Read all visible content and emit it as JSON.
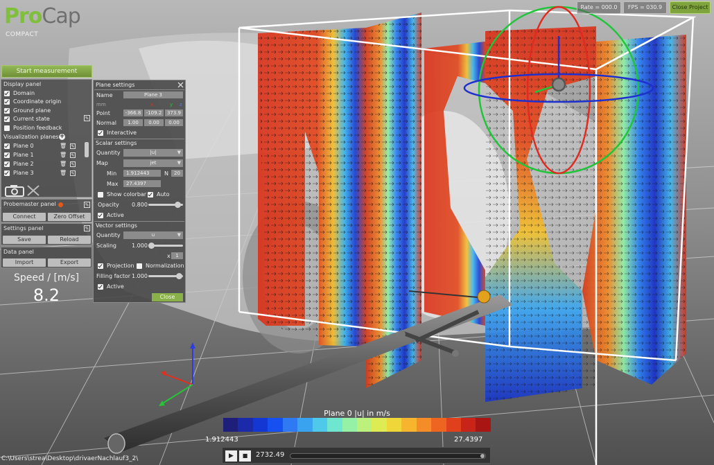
{
  "logo": {
    "pro": "Pro",
    "cap": "Cap",
    "subtitle": "COMPACT"
  },
  "status": {
    "rate": "Rate = 000.0",
    "fps": "FPS = 030.9",
    "close_project": "Close Project"
  },
  "start_button": "Start measurement",
  "display_panel": {
    "title": "Display panel",
    "items": [
      "Domain",
      "Coordinate origin",
      "Ground plane",
      "Current state",
      "Position feedback"
    ],
    "visualization_title": "Visualization planes",
    "planes": [
      "Plane 0",
      "Plane 1",
      "Plane 2",
      "Plane 3"
    ]
  },
  "probemaster": {
    "title": "Probemaster panel",
    "connect": "Connect",
    "zero_offset": "Zero Offset"
  },
  "settings_panel": {
    "title": "Settings panel",
    "save": "Save",
    "reload": "Reload"
  },
  "data_panel": {
    "title": "Data panel",
    "import": "Import",
    "export": "Export"
  },
  "speed": {
    "label": "Speed / [m/s]",
    "value": "8.2"
  },
  "plane_settings": {
    "title": "Plane settings",
    "name_label": "Name",
    "name_value": "Plane 3",
    "mm": "mm",
    "x": "x",
    "y": "y",
    "z": "z",
    "point_label": "Point",
    "point": [
      "-366.8",
      "-109.2",
      "373.9"
    ],
    "normal_label": "Normal",
    "normal": [
      "1.00",
      "0.00",
      "0.00"
    ],
    "interactive": "Interactive",
    "scalar_title": "Scalar settings",
    "quantity_label": "Quantity",
    "quantity_value": "|u|",
    "map_label": "Map",
    "map_value": "jet",
    "min_label": "Min",
    "min_value": "1.912443",
    "n_label": "N",
    "n_value": "20",
    "max_label": "Max",
    "max_value": "27.4397",
    "show_colorbar": "Show colorbar",
    "auto": "Auto",
    "opacity_label": "Opacity",
    "opacity_value": "0.800",
    "active": "Active",
    "vector_title": "Vector settings",
    "vquantity_label": "Quantity",
    "vquantity_value": "u",
    "scaling_label": "Scaling",
    "scaling_value": "1.000",
    "x_label": "x",
    "x_value": "1",
    "projection": "Projection",
    "normalization": "Normalization",
    "filling_label": "Filling factor",
    "filling_value": "1.000",
    "active2": "Active",
    "close": "Close"
  },
  "colorbar": {
    "title": "Plane 0 |u| in m/s",
    "min": "1.912443",
    "max": "27.4397",
    "colors": [
      "#1d1f7a",
      "#1a2aa8",
      "#1437d3",
      "#1750f0",
      "#2f79f3",
      "#3aa3f0",
      "#4fc9e9",
      "#6ee6d0",
      "#95f1a6",
      "#bdf17e",
      "#dcec52",
      "#efd73a",
      "#f7b52f",
      "#f48d27",
      "#ee6421",
      "#e1401c",
      "#c92418",
      "#a81614"
    ]
  },
  "player": {
    "time": "2732.49",
    "play": "▶",
    "stop": "■"
  },
  "file_path": "C:\\Users\\strea\\Desktop\\drivaerNachlauf3_2\\"
}
